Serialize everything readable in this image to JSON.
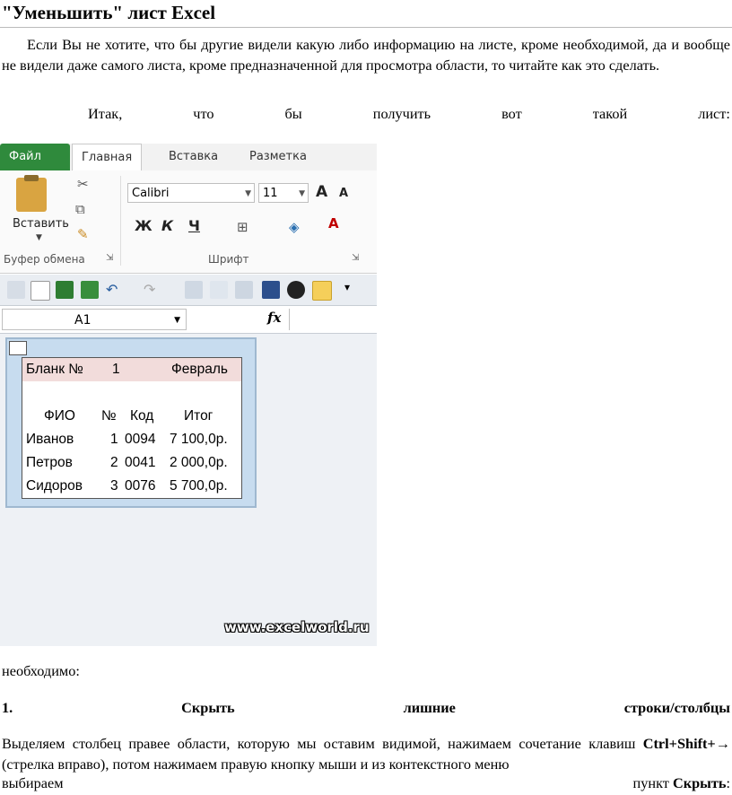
{
  "doc": {
    "title": "\"Уменьшить\" лист Excel",
    "p1": "Если Вы не хотите, что бы другие видели какую либо информацию на листе, кроме необходимой, да и вообще не видели даже самого листа, кроме предназначенной для просмотра области, то читайте как это сделать.",
    "line2": [
      "Итак,",
      "что",
      "бы",
      "получить",
      "вот",
      "такой",
      "лист:"
    ],
    "line3": "необходимо:",
    "line4": [
      "1.",
      "Скрыть",
      "лишние",
      "строки/столбцы"
    ],
    "p5_a": "Выделяем столбец правее области, которую мы оставим видимой, нажимаем сочетание клавиш ",
    "p5_keys": "Ctrl+Shift+→",
    "p5_b": " (стрелка вправо), потом нажимаем правую кнопку мыши и из контекстного меню",
    "p5_last_left": "выбираем",
    "p5_last_right_a": "пункт ",
    "p5_last_right_b": "Скрыть",
    "p5_last_right_c": ":"
  },
  "excel": {
    "tabs": {
      "file": "Файл",
      "home": "Главная",
      "insert": "Вставка",
      "layout": "Разметка страницы"
    },
    "ribbon": {
      "paste": "Вставить",
      "clipboard_group": "Буфер обмена",
      "font_group": "Шрифт",
      "font_name": "Calibri",
      "font_size": "11",
      "grow": "A",
      "shrink": "A",
      "bold": "Ж",
      "italic": "К",
      "underline": "Ч"
    },
    "name_box": "A1",
    "fx": "fx",
    "table": {
      "row1": [
        "Бланк №",
        "1",
        "Февраль"
      ],
      "headers": [
        "ФИО",
        "№",
        "Код",
        "Итог"
      ],
      "rows": [
        [
          "Иванов",
          "1",
          "0094",
          "7 100,0р."
        ],
        [
          "Петров",
          "2",
          "0041",
          "2 000,0р."
        ],
        [
          "Сидоров",
          "3",
          "0076",
          "5 700,0р."
        ]
      ]
    },
    "watermark": "www.excelworld.ru"
  }
}
